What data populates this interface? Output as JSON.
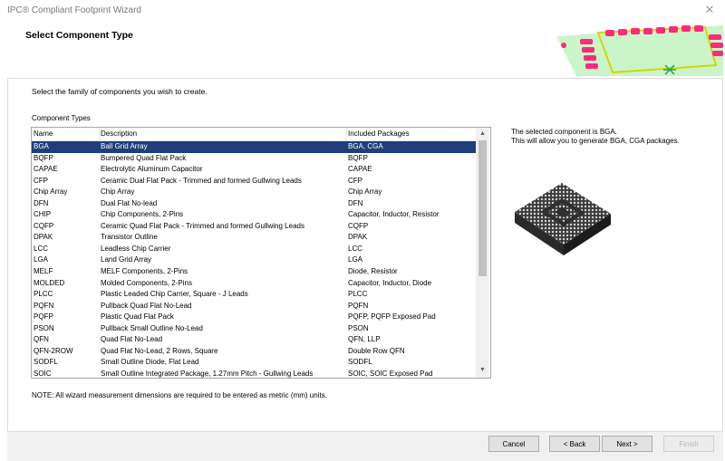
{
  "window": {
    "title": "IPC® Compliant Footprint Wizard",
    "close_glyph": "✕"
  },
  "header": {
    "heading": "Select Component Type"
  },
  "instruction": "Select the family of components you wish to create.",
  "component_types": {
    "group_label": "Component Types",
    "columns": [
      "Name",
      "Description",
      "Included Packages"
    ],
    "rows": [
      [
        "BGA",
        "Ball Grid Array",
        "BGA, CGA"
      ],
      [
        "BQFP",
        "Bumpered Quad Flat Pack",
        "BQFP"
      ],
      [
        "CAPAE",
        "Electrolytic Aluminum Capacitor",
        "CAPAE"
      ],
      [
        "CFP",
        "Ceramic Dual Flat Pack - Trimmed and formed Gullwing Leads",
        "CFP"
      ],
      [
        "Chip Array",
        "Chip Array",
        "Chip Array"
      ],
      [
        "DFN",
        "Dual Flat No-lead",
        "DFN"
      ],
      [
        "CHIP",
        "Chip Components, 2-Pins",
        "Capacitor, Inductor, Resistor"
      ],
      [
        "CQFP",
        "Ceramic Quad Flat Pack - Trimmed and formed Gullwing Leads",
        "CQFP"
      ],
      [
        "DPAK",
        "Transistor Outline",
        "DPAK"
      ],
      [
        "LCC",
        "Leadless Chip Carrier",
        "LCC"
      ],
      [
        "LGA",
        "Land Grid Array",
        "LGA"
      ],
      [
        "MELF",
        "MELF Components, 2-Pins",
        "Diode, Resistor"
      ],
      [
        "MOLDED",
        "Molded Components, 2-Pins",
        "Capacitor, Inductor, Diode"
      ],
      [
        "PLCC",
        "Plastic Leaded Chip Carrier, Square - J Leads",
        "PLCC"
      ],
      [
        "PQFN",
        "Pullback Quad Flat No-Lead",
        "PQFN"
      ],
      [
        "PQFP",
        "Plastic Quad Flat Pack",
        "PQFP, PQFP Exposed Pad"
      ],
      [
        "PSON",
        "Pullback Small Outline No-Lead",
        "PSON"
      ],
      [
        "QFN",
        "Quad Flat No-Lead",
        "QFN, LLP"
      ],
      [
        "QFN-2ROW",
        "Quad Flat No-Lead, 2 Rows, Square",
        "Double Row QFN"
      ],
      [
        "SODFL",
        "Small Outline Diode, Flat Lead",
        "SODFL"
      ],
      [
        "SOIC",
        "Small Outline Integrated Package, 1.27mm Pitch - Gullwing Leads",
        "SOIC, SOIC Exposed Pad"
      ]
    ],
    "selected_index": 0
  },
  "description": {
    "line1": "The selected component is BGA.",
    "line2": "This will allow you to generate BGA, CGA packages."
  },
  "note": "NOTE: All wizard measurement dimensions are required to be entered as metric (mm) units.",
  "buttons": {
    "cancel": "Cancel",
    "back": "< Back",
    "next": "Next >",
    "finish": "Finish"
  },
  "colors": {
    "selection": "#1f3e7c",
    "pads": "#ff2a7a",
    "silkscreen": "#d6d600",
    "board": "#c9f5c9"
  }
}
